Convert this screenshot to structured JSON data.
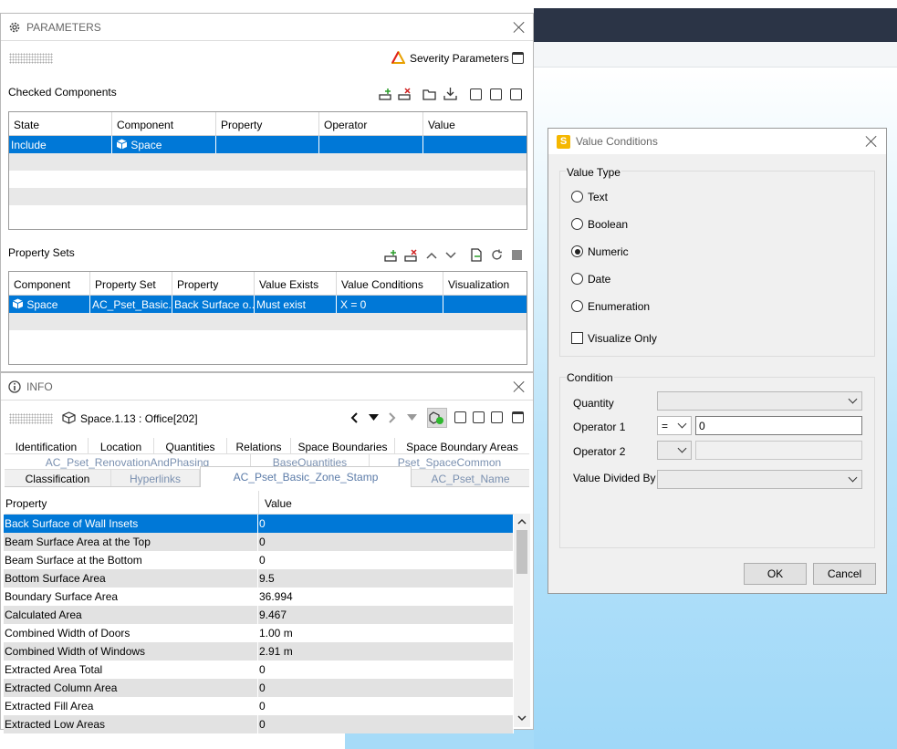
{
  "colors": {
    "selection": "#0078d7",
    "viewport_top": "#2b3446",
    "sky": "#a6dbf8"
  },
  "parameters": {
    "title": "PARAMETERS",
    "severity_label": "Severity Parameters",
    "checked_components": {
      "label": "Checked Components",
      "headers": [
        "State",
        "Component",
        "Property",
        "Operator",
        "Value"
      ],
      "rows": [
        {
          "state": "Include",
          "component": "Space",
          "property": "",
          "operator": "",
          "value": ""
        }
      ]
    },
    "property_sets": {
      "label": "Property Sets",
      "headers": [
        "Component",
        "Property Set",
        "Property",
        "Value Exists",
        "Value Conditions",
        "Visualization"
      ],
      "rows": [
        {
          "component": "Space",
          "pset": "AC_Pset_Basic...",
          "property": "Back Surface o...",
          "exists": "Must exist",
          "conditions": "X = 0",
          "visualization": ""
        }
      ]
    }
  },
  "info": {
    "title": "INFO",
    "element": "Space.1.13 : Office[202]",
    "tabs_row1": [
      "Identification",
      "Location",
      "Quantities",
      "Relations",
      "Space Boundaries",
      "Space Boundary Areas"
    ],
    "tabs_row2": [
      "AC_Pset_RenovationAndPhasing",
      "BaseQuantities",
      "Pset_SpaceCommon"
    ],
    "tabs_row3": [
      "Classification",
      "Hyperlinks",
      "AC_Pset_Basic_Zone_Stamp",
      "AC_Pset_Name"
    ],
    "table_headers": [
      "Property",
      "Value"
    ],
    "rows": [
      {
        "p": "Back Surface of Wall Insets",
        "v": "0"
      },
      {
        "p": "Beam Surface Area at the Top",
        "v": "0"
      },
      {
        "p": "Beam Surface at the Bottom",
        "v": "0"
      },
      {
        "p": "Bottom Surface Area",
        "v": "9.5"
      },
      {
        "p": "Boundary Surface Area",
        "v": "36.994"
      },
      {
        "p": "Calculated Area",
        "v": "9.467"
      },
      {
        "p": "Combined Width of Doors",
        "v": "1.00 m"
      },
      {
        "p": "Combined Width of Windows",
        "v": "2.91 m"
      },
      {
        "p": "Extracted Area Total",
        "v": "0"
      },
      {
        "p": "Extracted Column Area",
        "v": "0"
      },
      {
        "p": "Extracted Fill Area",
        "v": "0"
      },
      {
        "p": "Extracted Low Areas",
        "v": "0"
      }
    ]
  },
  "value_conditions": {
    "title": "Value Conditions",
    "app_icon_letter": "S",
    "value_type_label": "Value Type",
    "types": [
      "Text",
      "Boolean",
      "Numeric",
      "Date",
      "Enumeration"
    ],
    "selected_type": "Numeric",
    "visualize_only": "Visualize Only",
    "condition_label": "Condition",
    "quantity_label": "Quantity",
    "operator1_label": "Operator 1",
    "operator1_symbol": "=",
    "operator1_value": "0",
    "operator2_label": "Operator 2",
    "divided_by_label": "Value Divided By",
    "ok": "OK",
    "cancel": "Cancel"
  }
}
